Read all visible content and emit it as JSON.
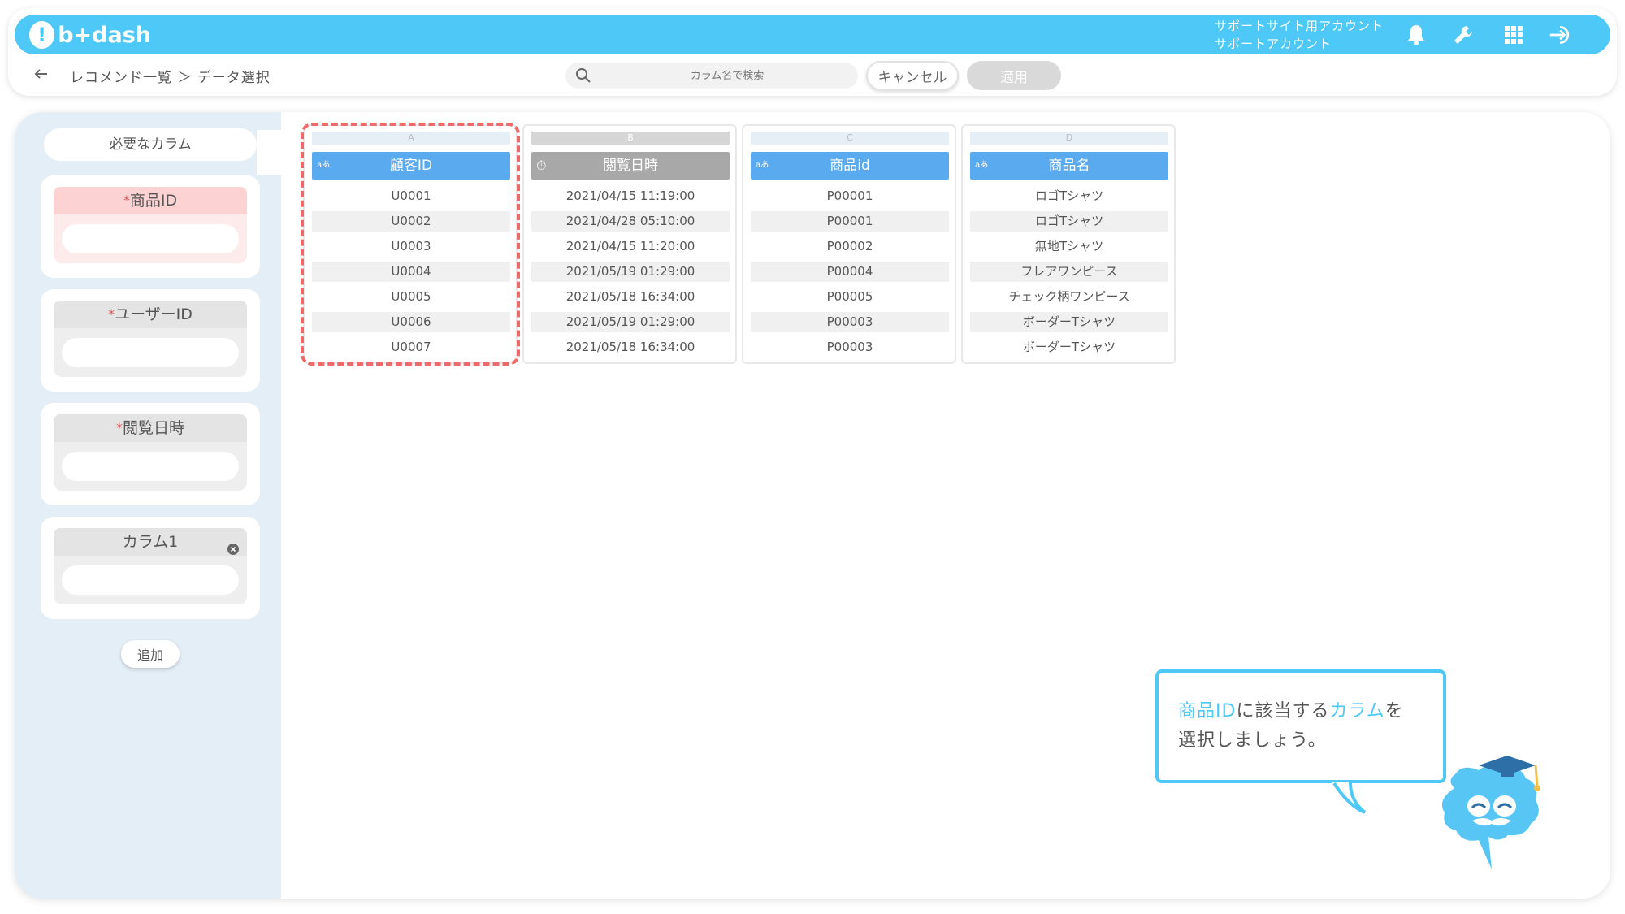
{
  "header": {
    "logo_text": "b+dash",
    "account_line1": "サポートサイト用アカウント",
    "account_line2": "サポートアカウント",
    "icons": [
      "bell-icon",
      "wrench-icon",
      "grid-icon",
      "logout-icon"
    ],
    "accent_color": "#4ec8f7"
  },
  "toolbar": {
    "breadcrumb": "レコメンド一覧 ＞ データ選択",
    "search_placeholder": "カラム名で検索",
    "cancel_label": "キャンセル",
    "apply_label": "適用"
  },
  "sidebar": {
    "title": "必要なカラム",
    "slots": [
      {
        "required_mark": "*",
        "label": "商品ID",
        "active": true
      },
      {
        "required_mark": "*",
        "label": "ユーザーID",
        "active": false
      },
      {
        "required_mark": "*",
        "label": "閲覧日時",
        "active": false
      },
      {
        "required_mark": "",
        "label": "カラム1",
        "active": false,
        "removable": true
      }
    ],
    "add_label": "追加"
  },
  "columns": [
    {
      "letter": "A",
      "type_icon": "aあ",
      "name": "顧客ID",
      "selected": true,
      "style": "blue",
      "rows": [
        "U0001",
        "U0002",
        "U0003",
        "U0004",
        "U0005",
        "U0006",
        "U0007"
      ]
    },
    {
      "letter": "B",
      "type_icon": "⏱",
      "name": "閲覧日時",
      "selected": false,
      "style": "gray",
      "rows": [
        "2021/04/15 11:19:00",
        "2021/04/28 05:10:00",
        "2021/04/15 11:20:00",
        "2021/05/19 01:29:00",
        "2021/05/18 16:34:00",
        "2021/05/19 01:29:00",
        "2021/05/18 16:34:00"
      ]
    },
    {
      "letter": "C",
      "type_icon": "aあ",
      "name": "商品id",
      "selected": false,
      "style": "blue",
      "rows": [
        "P00001",
        "P00001",
        "P00002",
        "P00004",
        "P00005",
        "P00003",
        "P00003"
      ]
    },
    {
      "letter": "D",
      "type_icon": "aあ",
      "name": "商品名",
      "selected": false,
      "style": "blue",
      "rows": [
        "ロゴTシャツ",
        "ロゴTシャツ",
        "無地Tシャツ",
        "フレアワンピース",
        "チェック柄ワンピース",
        "ボーダーTシャツ",
        "ボーダーTシャツ"
      ]
    }
  ],
  "tooltip": {
    "part1_highlight": "商品ID",
    "part2": "に該当する",
    "part3_highlight": "カラム",
    "part4": "を",
    "line2": "選択しましょう。"
  }
}
